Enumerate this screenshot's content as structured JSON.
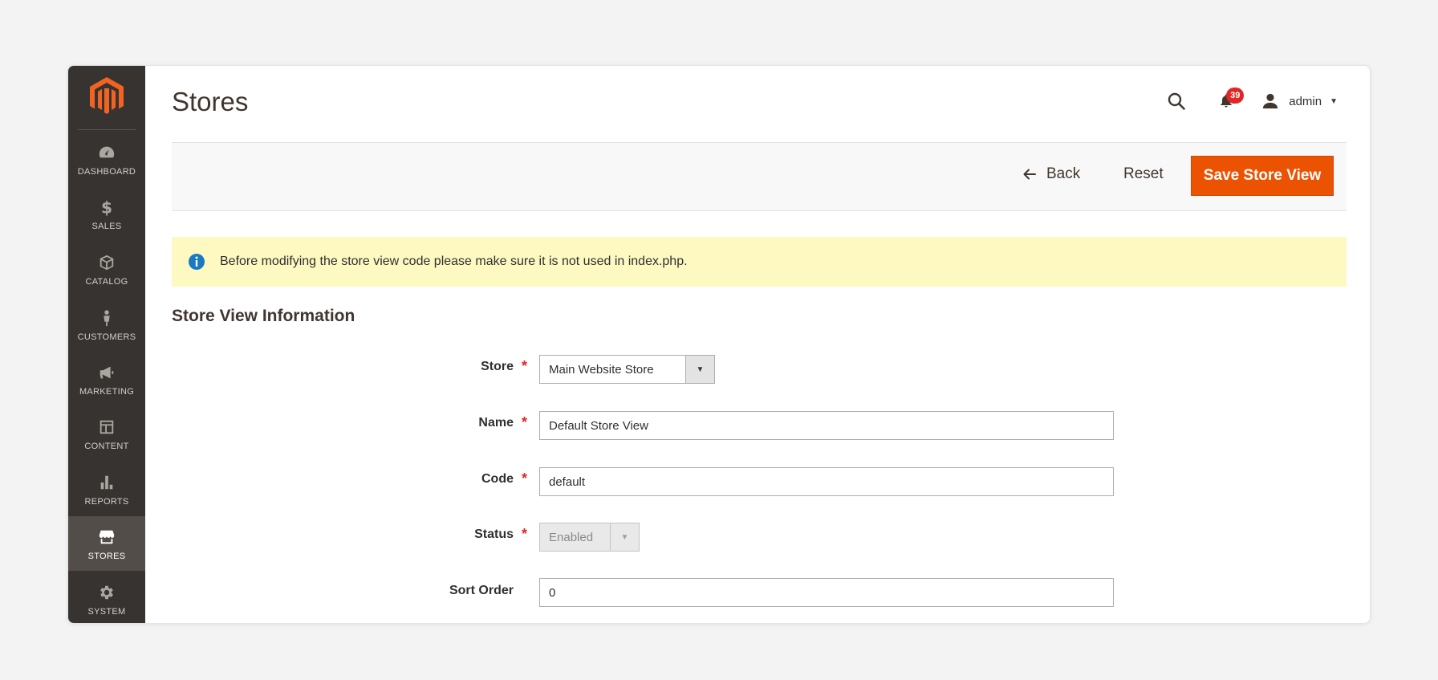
{
  "sidebar": {
    "logo_icon": "magento-logo-icon",
    "items": [
      {
        "label": "DASHBOARD",
        "icon": "speedometer-icon"
      },
      {
        "label": "SALES",
        "icon": "dollar-icon"
      },
      {
        "label": "CATALOG",
        "icon": "box-icon"
      },
      {
        "label": "CUSTOMERS",
        "icon": "person-icon"
      },
      {
        "label": "MARKETING",
        "icon": "megaphone-icon"
      },
      {
        "label": "CONTENT",
        "icon": "layout-icon"
      },
      {
        "label": "REPORTS",
        "icon": "bar-chart-icon"
      },
      {
        "label": "STORES",
        "icon": "storefront-icon",
        "active": true
      },
      {
        "label": "SYSTEM",
        "icon": "gear-icon"
      }
    ]
  },
  "header": {
    "title": "Stores",
    "notifications_count": "39",
    "user_name": "admin",
    "caret": "▼"
  },
  "actions": {
    "back_label": "Back",
    "reset_label": "Reset",
    "save_label": "Save Store View"
  },
  "notice": {
    "text": "Before modifying the store view code please make sure it is not used in index.php."
  },
  "form": {
    "section_title": "Store View Information",
    "required_mark": "*",
    "store": {
      "label": "Store",
      "value": "Main Website Store",
      "arrow": "▼"
    },
    "name": {
      "label": "Name",
      "value": "Default Store View"
    },
    "code": {
      "label": "Code",
      "value": "default"
    },
    "status": {
      "label": "Status",
      "value": "Enabled",
      "arrow": "▼",
      "disabled": true
    },
    "sort_order": {
      "label": "Sort Order",
      "value": "0"
    }
  },
  "colors": {
    "sidebar_bg": "#373330",
    "sidebar_active": "#524d49",
    "accent": "#eb5202",
    "notice_bg": "#fdf9c1",
    "badge": "#e22626",
    "required": "#e22626"
  }
}
